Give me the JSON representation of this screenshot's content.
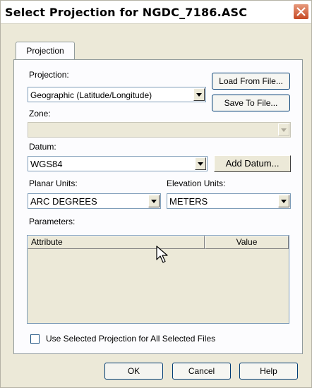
{
  "window": {
    "title": "Select Projection for NGDC_7186.ASC"
  },
  "tabs": [
    {
      "label": "Projection"
    }
  ],
  "projection": {
    "label": "Projection:",
    "value": "Geographic (Latitude/Longitude)",
    "load_button": "Load From File...",
    "save_button": "Save To File..."
  },
  "zone": {
    "label": "Zone:",
    "value": ""
  },
  "datum": {
    "label": "Datum:",
    "value": "WGS84",
    "add_button": "Add Datum..."
  },
  "planar_units": {
    "label": "Planar Units:",
    "value": "ARC DEGREES"
  },
  "elevation_units": {
    "label": "Elevation Units:",
    "value": "METERS"
  },
  "parameters": {
    "label": "Parameters:",
    "columns": [
      "Attribute",
      "Value"
    ],
    "rows": []
  },
  "use_for_all": {
    "label": "Use Selected Projection for All Selected Files",
    "checked": false
  },
  "footer": {
    "ok": "OK",
    "cancel": "Cancel",
    "help": "Help"
  }
}
